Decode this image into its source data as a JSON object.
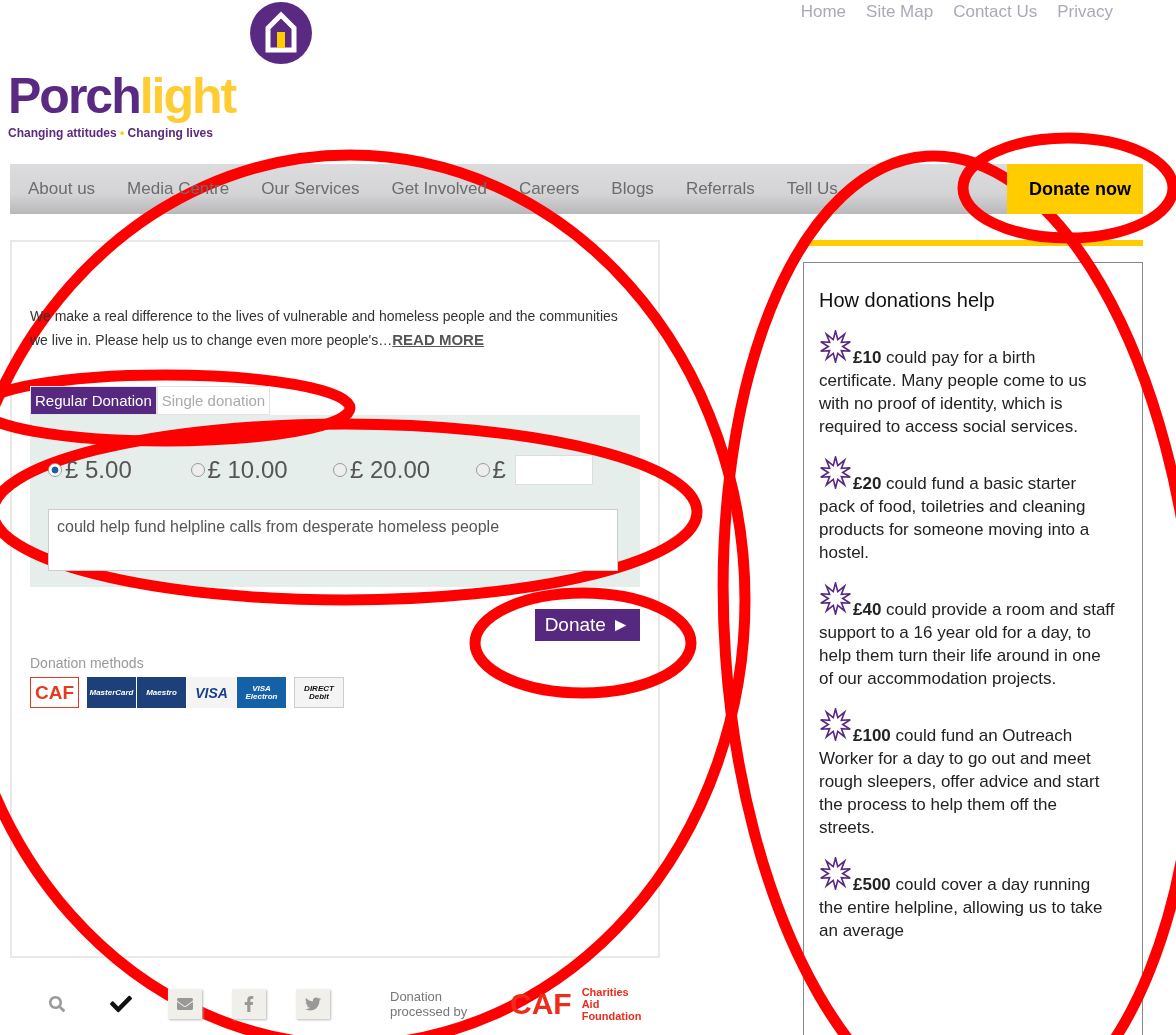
{
  "top_links": [
    "Home",
    "Site Map",
    "Contact Us",
    "Privacy"
  ],
  "logo": {
    "name_parts": [
      "Porch",
      "light"
    ],
    "tagline_parts": [
      "Changing attitudes",
      "•",
      "Changing lives"
    ]
  },
  "nav": [
    {
      "label": "About us",
      "kind": "link"
    },
    {
      "label": "Media Centre",
      "kind": "link"
    },
    {
      "label": "Our Services",
      "kind": "link"
    },
    {
      "label": "Get Involved",
      "kind": "link"
    },
    {
      "label": "Careers",
      "kind": "link"
    },
    {
      "label": "Blogs",
      "kind": "link"
    },
    {
      "label": "Referrals",
      "kind": "link"
    },
    {
      "label": "Tell Us",
      "kind": "link"
    },
    {
      "label": "Donate now",
      "kind": "cta"
    }
  ],
  "intro": {
    "text": "We make a real difference to the lives of vulnerable and homeless people and the communities we live in. Please help us to change even more people's…",
    "link": "READ MORE"
  },
  "tabs": [
    {
      "label": "Regular Donation",
      "selected": true
    },
    {
      "label": "Single donation",
      "selected": false
    }
  ],
  "amounts": [
    {
      "label": "£ 5.00",
      "kind": "fixed",
      "selected": true
    },
    {
      "label": "£ 10.00",
      "kind": "fixed",
      "selected": false
    },
    {
      "label": "£ 20.00",
      "kind": "fixed",
      "selected": false
    },
    {
      "label": "£",
      "kind": "other",
      "selected": false
    }
  ],
  "description": "could help fund helpline calls from desperate homeless people",
  "donate_button": "Donate ►",
  "methods": {
    "title": "Donation methods",
    "cards": [
      {
        "kind": "caf",
        "label": "CAF"
      },
      {
        "kind": "mastercard",
        "label": "MasterCard"
      },
      {
        "kind": "maestro",
        "label": "Maestro"
      },
      {
        "kind": "visa",
        "label": "VISA"
      },
      {
        "kind": "electron",
        "label": "VISA Electron"
      },
      {
        "kind": "debit",
        "label": "DIRECT Debit"
      }
    ]
  },
  "footer": {
    "processed_by": "Donation processed by",
    "caf": "CAF",
    "caf_name": "Charities Aid Foundation"
  },
  "help": {
    "title": "How donations help",
    "items": [
      "**£10** could pay for a birth certificate. Many people come to us with no proof of identity, which is required to access social services.",
      "**£20** could fund a basic starter pack of food, toiletries and cleaning products for someone moving into a hostel.",
      "**£40** could provide a room and staff support to a 16 year old for a day, to help them turn their life around in one of our accommodation projects.",
      "**£100** could fund an Outreach Worker for a day to go out and meet rough sleepers, offer advice and start the process to help them off the streets.",
      "**£500** could cover a day running the entire helpline, allowing us to take an average"
    ]
  },
  "markup": {
    "kind": "ellipses",
    "color": "#ff0000"
  }
}
